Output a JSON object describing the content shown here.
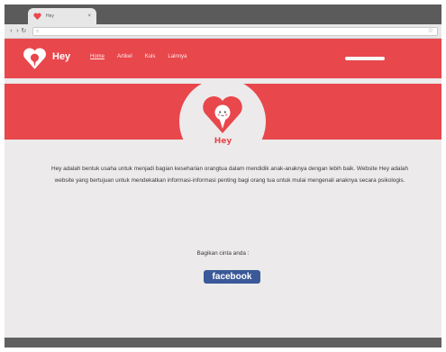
{
  "browser": {
    "tab_title": "Hey",
    "tab_close_icon": "close-icon",
    "nav_buttons": [
      "‹",
      "›",
      "↻"
    ]
  },
  "header": {
    "brand": "Hey",
    "nav": [
      {
        "label": "Home",
        "active": true
      },
      {
        "label": "Artikel",
        "active": false
      },
      {
        "label": "Kuis",
        "active": false
      },
      {
        "label": "Lainnya",
        "active": false
      }
    ]
  },
  "hero": {
    "brand": "Hey"
  },
  "main": {
    "description": "Hey adalah bentuk usaha untuk menjadi bagian keseharian orangtua dalam mendidik anak-anaknya dengan lebih baik. Website Hey adalah website yang bertujuan untuk mendekatkan informasi-informasi penting bagi orang tua untuk mulai mengenali anaknya secara psikologis.",
    "share_label": "Bagikan cinta anda :",
    "facebook_label": "facebook"
  },
  "colors": {
    "brand_red": "#e8474c",
    "background": "#eceaea",
    "facebook_blue": "#3b5998"
  }
}
